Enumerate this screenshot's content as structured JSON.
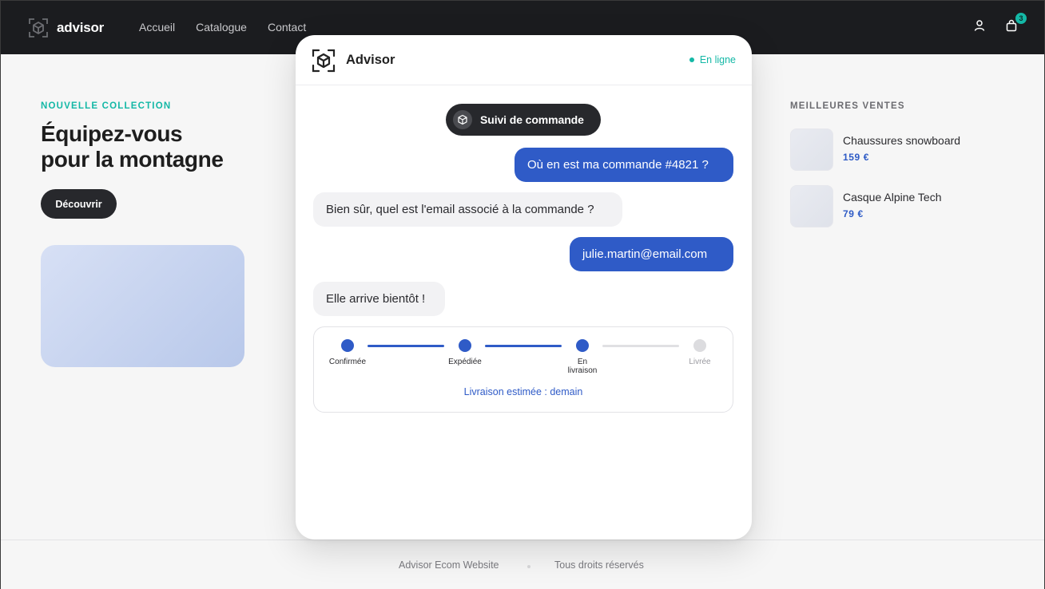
{
  "header": {
    "brand": "advisor",
    "nav": [
      "Accueil",
      "Catalogue",
      "Contact"
    ],
    "cart_count": "3",
    "icons": [
      "logo-icon",
      "user-icon",
      "bag-icon"
    ]
  },
  "hero": {
    "kicker": "NOUVELLE COLLECTION",
    "title_line1": "Équipez-vous",
    "title_line2": "pour la montagne",
    "cta": "Découvrir"
  },
  "best_sellers": {
    "title": "MEILLEURES VENTES",
    "items": [
      {
        "name": "Chaussures snowboard",
        "price": "159 €"
      },
      {
        "name": "Casque Alpine Tech",
        "price": "79 €"
      }
    ]
  },
  "footer": {
    "left": "Advisor Ecom Website",
    "right": "Tous droits réservés"
  },
  "chat": {
    "title": "Advisor",
    "status": "En ligne",
    "pill": "Suivi de commande",
    "messages": [
      {
        "from": "user",
        "text": "Où en est ma commande #4821 ?"
      },
      {
        "from": "bot",
        "text": "Bien sûr, quel est l'email associé à la commande ?"
      },
      {
        "from": "user",
        "text": "julie.martin@email.com"
      },
      {
        "from": "bot",
        "text": "Elle arrive bientôt !"
      }
    ],
    "tracker": {
      "steps": [
        {
          "label": "Confirmée",
          "done": true
        },
        {
          "label": "Expédiée",
          "done": true
        },
        {
          "label_line1": "En",
          "label_line2": "livraison",
          "done": true
        },
        {
          "label": "Livrée",
          "done": false
        }
      ],
      "eta": "Livraison estimée : demain"
    },
    "colors": {
      "accent": "#2f5bc7",
      "online": "#14b8a6",
      "dark": "#27282c"
    }
  }
}
